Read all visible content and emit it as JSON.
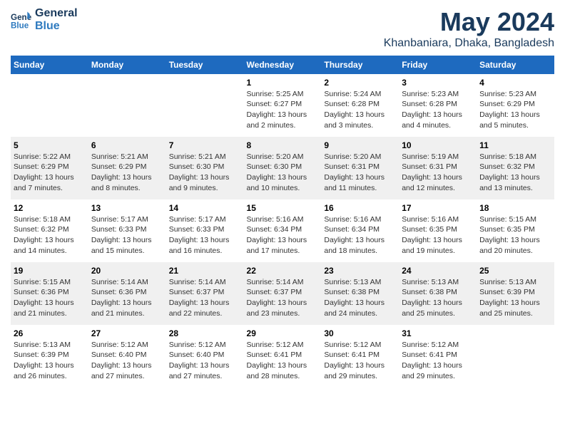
{
  "logo": {
    "line1": "General",
    "line2": "Blue"
  },
  "title": "May 2024",
  "subtitle": "Khanbaniara, Dhaka, Bangladesh",
  "days_header": [
    "Sunday",
    "Monday",
    "Tuesday",
    "Wednesday",
    "Thursday",
    "Friday",
    "Saturday"
  ],
  "weeks": [
    [
      {
        "day": "",
        "info": ""
      },
      {
        "day": "",
        "info": ""
      },
      {
        "day": "",
        "info": ""
      },
      {
        "day": "1",
        "info": "Sunrise: 5:25 AM\nSunset: 6:27 PM\nDaylight: 13 hours\nand 2 minutes."
      },
      {
        "day": "2",
        "info": "Sunrise: 5:24 AM\nSunset: 6:28 PM\nDaylight: 13 hours\nand 3 minutes."
      },
      {
        "day": "3",
        "info": "Sunrise: 5:23 AM\nSunset: 6:28 PM\nDaylight: 13 hours\nand 4 minutes."
      },
      {
        "day": "4",
        "info": "Sunrise: 5:23 AM\nSunset: 6:29 PM\nDaylight: 13 hours\nand 5 minutes."
      }
    ],
    [
      {
        "day": "5",
        "info": "Sunrise: 5:22 AM\nSunset: 6:29 PM\nDaylight: 13 hours\nand 7 minutes."
      },
      {
        "day": "6",
        "info": "Sunrise: 5:21 AM\nSunset: 6:29 PM\nDaylight: 13 hours\nand 8 minutes."
      },
      {
        "day": "7",
        "info": "Sunrise: 5:21 AM\nSunset: 6:30 PM\nDaylight: 13 hours\nand 9 minutes."
      },
      {
        "day": "8",
        "info": "Sunrise: 5:20 AM\nSunset: 6:30 PM\nDaylight: 13 hours\nand 10 minutes."
      },
      {
        "day": "9",
        "info": "Sunrise: 5:20 AM\nSunset: 6:31 PM\nDaylight: 13 hours\nand 11 minutes."
      },
      {
        "day": "10",
        "info": "Sunrise: 5:19 AM\nSunset: 6:31 PM\nDaylight: 13 hours\nand 12 minutes."
      },
      {
        "day": "11",
        "info": "Sunrise: 5:18 AM\nSunset: 6:32 PM\nDaylight: 13 hours\nand 13 minutes."
      }
    ],
    [
      {
        "day": "12",
        "info": "Sunrise: 5:18 AM\nSunset: 6:32 PM\nDaylight: 13 hours\nand 14 minutes."
      },
      {
        "day": "13",
        "info": "Sunrise: 5:17 AM\nSunset: 6:33 PM\nDaylight: 13 hours\nand 15 minutes."
      },
      {
        "day": "14",
        "info": "Sunrise: 5:17 AM\nSunset: 6:33 PM\nDaylight: 13 hours\nand 16 minutes."
      },
      {
        "day": "15",
        "info": "Sunrise: 5:16 AM\nSunset: 6:34 PM\nDaylight: 13 hours\nand 17 minutes."
      },
      {
        "day": "16",
        "info": "Sunrise: 5:16 AM\nSunset: 6:34 PM\nDaylight: 13 hours\nand 18 minutes."
      },
      {
        "day": "17",
        "info": "Sunrise: 5:16 AM\nSunset: 6:35 PM\nDaylight: 13 hours\nand 19 minutes."
      },
      {
        "day": "18",
        "info": "Sunrise: 5:15 AM\nSunset: 6:35 PM\nDaylight: 13 hours\nand 20 minutes."
      }
    ],
    [
      {
        "day": "19",
        "info": "Sunrise: 5:15 AM\nSunset: 6:36 PM\nDaylight: 13 hours\nand 21 minutes."
      },
      {
        "day": "20",
        "info": "Sunrise: 5:14 AM\nSunset: 6:36 PM\nDaylight: 13 hours\nand 21 minutes."
      },
      {
        "day": "21",
        "info": "Sunrise: 5:14 AM\nSunset: 6:37 PM\nDaylight: 13 hours\nand 22 minutes."
      },
      {
        "day": "22",
        "info": "Sunrise: 5:14 AM\nSunset: 6:37 PM\nDaylight: 13 hours\nand 23 minutes."
      },
      {
        "day": "23",
        "info": "Sunrise: 5:13 AM\nSunset: 6:38 PM\nDaylight: 13 hours\nand 24 minutes."
      },
      {
        "day": "24",
        "info": "Sunrise: 5:13 AM\nSunset: 6:38 PM\nDaylight: 13 hours\nand 25 minutes."
      },
      {
        "day": "25",
        "info": "Sunrise: 5:13 AM\nSunset: 6:39 PM\nDaylight: 13 hours\nand 25 minutes."
      }
    ],
    [
      {
        "day": "26",
        "info": "Sunrise: 5:13 AM\nSunset: 6:39 PM\nDaylight: 13 hours\nand 26 minutes."
      },
      {
        "day": "27",
        "info": "Sunrise: 5:12 AM\nSunset: 6:40 PM\nDaylight: 13 hours\nand 27 minutes."
      },
      {
        "day": "28",
        "info": "Sunrise: 5:12 AM\nSunset: 6:40 PM\nDaylight: 13 hours\nand 27 minutes."
      },
      {
        "day": "29",
        "info": "Sunrise: 5:12 AM\nSunset: 6:41 PM\nDaylight: 13 hours\nand 28 minutes."
      },
      {
        "day": "30",
        "info": "Sunrise: 5:12 AM\nSunset: 6:41 PM\nDaylight: 13 hours\nand 29 minutes."
      },
      {
        "day": "31",
        "info": "Sunrise: 5:12 AM\nSunset: 6:41 PM\nDaylight: 13 hours\nand 29 minutes."
      },
      {
        "day": "",
        "info": ""
      }
    ]
  ]
}
